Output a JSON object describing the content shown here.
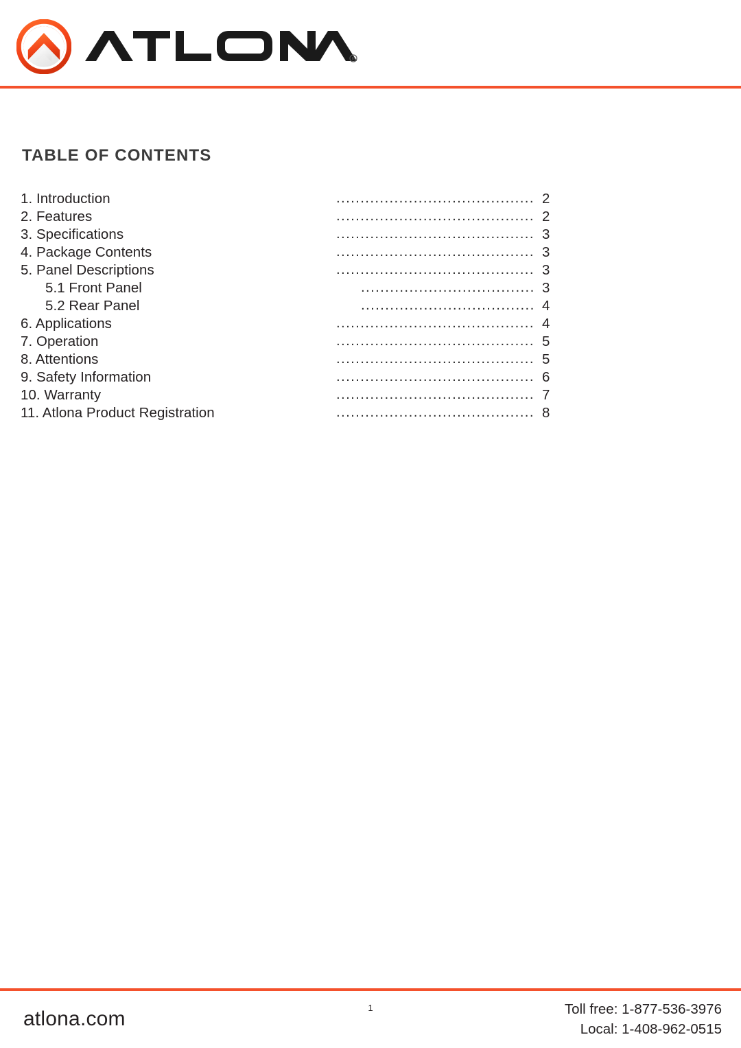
{
  "document": {
    "brand": "ATLONA",
    "registered_mark": "®",
    "accent_color": "#f4512c",
    "text_color": "#231f20",
    "heading_color": "#3b3b3b"
  },
  "header": {
    "logo_icon": "atlona-chevron-logo-icon",
    "wordmark": "ATLONA"
  },
  "toc": {
    "title": "TABLE OF CONTENTS",
    "leader": "........................................................",
    "entries": [
      {
        "label": "1. Introduction",
        "page": "2",
        "sub": false
      },
      {
        "label": "2. Features",
        "page": "2",
        "sub": false
      },
      {
        "label": "3. Specifications",
        "page": "3",
        "sub": false
      },
      {
        "label": "4. Package Contents",
        "page": "3",
        "sub": false
      },
      {
        "label": "5. Panel Descriptions",
        "page": "3",
        "sub": false
      },
      {
        "label": "5.1 Front Panel",
        "page": "3",
        "sub": true
      },
      {
        "label": "5.2 Rear Panel",
        "page": "4",
        "sub": true
      },
      {
        "label": "6. Applications",
        "page": "4",
        "sub": false
      },
      {
        "label": "7. Operation",
        "page": "5",
        "sub": false
      },
      {
        "label": "8. Attentions",
        "page": "5",
        "sub": false
      },
      {
        "label": "9. Safety Information",
        "page": "6",
        "sub": false
      },
      {
        "label": "10. Warranty",
        "page": "7",
        "sub": false
      },
      {
        "label": "11. Atlona Product Registration",
        "page": "8",
        "sub": false
      }
    ]
  },
  "footer": {
    "website": "atlona.com",
    "page_number": "1",
    "toll_free": "Toll free: 1-877-536-3976",
    "local": "Local: 1-408-962-0515"
  }
}
